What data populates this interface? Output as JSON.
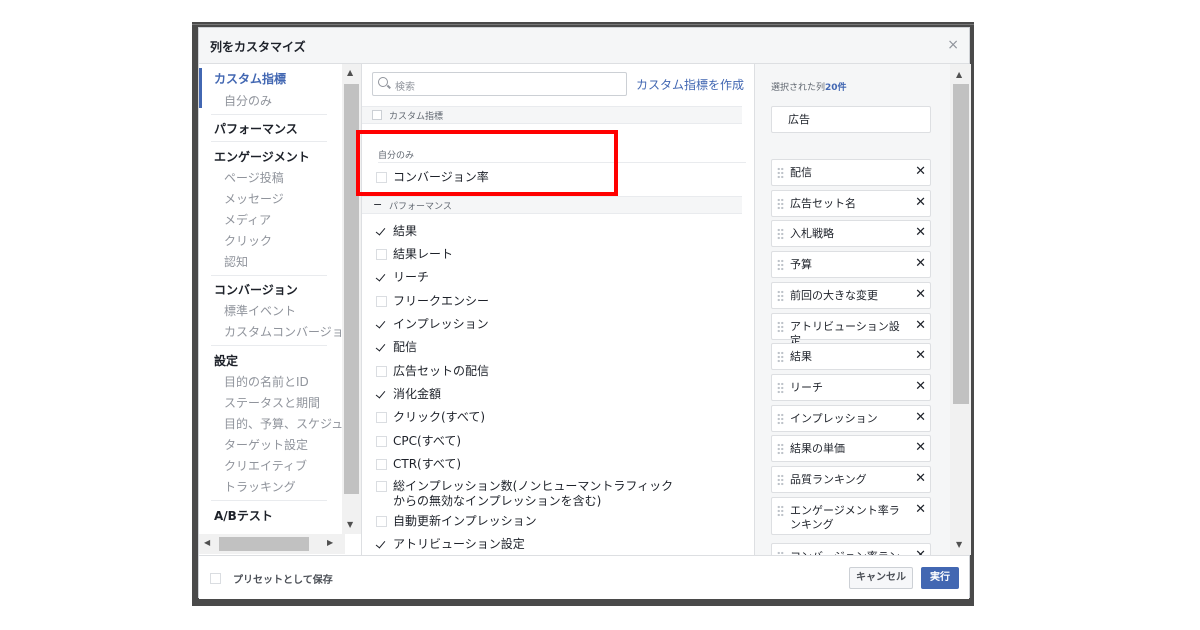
{
  "dialog": {
    "title": "列をカスタマイズ",
    "close": "×"
  },
  "leftnav": {
    "sections": [
      {
        "label": "カスタム指標",
        "active": true,
        "items": [
          "自分のみ"
        ]
      },
      {
        "label": "パフォーマンス",
        "items": []
      },
      {
        "label": "エンゲージメント",
        "items": [
          "ページ投稿",
          "メッセージ",
          "メディア",
          "クリック",
          "認知"
        ]
      },
      {
        "label": "コンバージョン",
        "items": [
          "標準イベント",
          "カスタムコンバージョン"
        ]
      },
      {
        "label": "設定",
        "items": [
          "目的の名前とID",
          "ステータスと期間",
          "目的、予算、スケジュール",
          "ターゲット設定",
          "クリエイティブ",
          "トラッキング"
        ]
      },
      {
        "label": "A/Bテスト",
        "items": []
      }
    ]
  },
  "search": {
    "placeholder": "検索",
    "create_link": "カスタム指標を作成"
  },
  "groups": {
    "custom": "カスタム指標",
    "own_only": "自分のみ",
    "performance": "パフォーマンス"
  },
  "custom_items": [
    {
      "label": "コンバージョン率",
      "checked": false
    }
  ],
  "performance_items": [
    {
      "label": "結果",
      "checked": true
    },
    {
      "label": "結果レート",
      "checked": false
    },
    {
      "label": "リーチ",
      "checked": true
    },
    {
      "label": "フリークエンシー",
      "checked": false
    },
    {
      "label": "インプレッション",
      "checked": true
    },
    {
      "label": "配信",
      "checked": true
    },
    {
      "label": "広告セットの配信",
      "checked": false
    },
    {
      "label": "消化金額",
      "checked": true
    },
    {
      "label": "クリック(すべて)",
      "checked": false
    },
    {
      "label": "CPC(すべて)",
      "checked": false
    },
    {
      "label": "CTR(すべて)",
      "checked": false
    },
    {
      "label": "総インプレッション数(ノンヒューマントラフィックからの無効なインプレッションを含む)",
      "line1": "総インプレッション数(ノンヒューマントラフィック",
      "line2": "からの無効なインプレッションを含む)",
      "checked": false
    },
    {
      "label": "自動更新インプレッション",
      "checked": false
    },
    {
      "label": "アトリビューション設定",
      "checked": true
    }
  ],
  "selected": {
    "heading_prefix": "選択された列",
    "count": "20件",
    "fixed": "広告",
    "items": [
      "配信",
      "広告セット名",
      "入札戦略",
      "予算",
      "前回の大きな変更",
      "アトリビューション設定",
      "結果",
      "リーチ",
      "インプレッション",
      "結果の単価",
      "品質ランキング",
      "エンゲージメント率ランキング",
      "コンバージョン率ランキング"
    ]
  },
  "footer": {
    "save_preset": "プリセットとして保存",
    "cancel": "キャンセル",
    "run": "実行"
  },
  "colors": {
    "accent": "#4267b2",
    "highlight_box": "#ff0000"
  }
}
